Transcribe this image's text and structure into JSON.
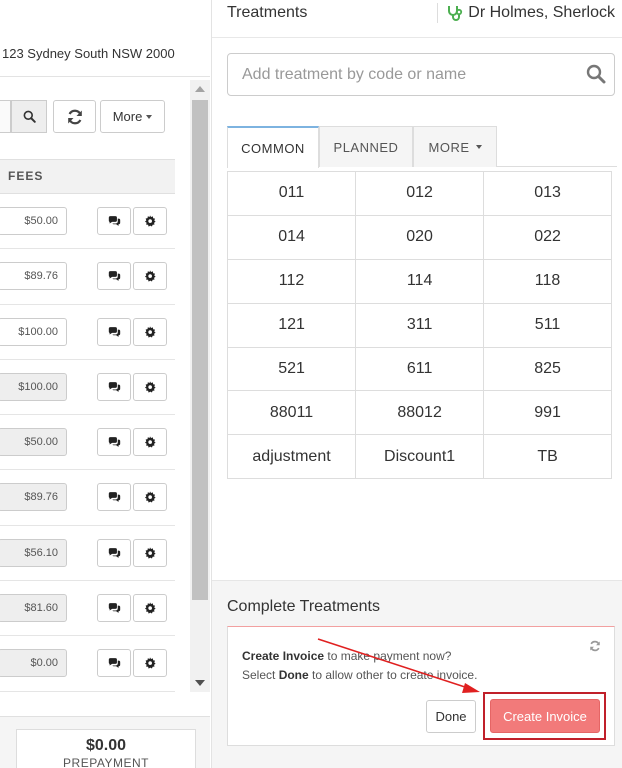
{
  "left": {
    "address": "123 Sydney South NSW 2000",
    "more_label": "More",
    "fees_header": "FEES",
    "fees": [
      {
        "amount": "$50.00",
        "readonly": false
      },
      {
        "amount": "$89.76",
        "readonly": false
      },
      {
        "amount": "$100.00",
        "readonly": false
      },
      {
        "amount": "$100.00",
        "readonly": true
      },
      {
        "amount": "$50.00",
        "readonly": true
      },
      {
        "amount": "$89.76",
        "readonly": true
      },
      {
        "amount": "$56.10",
        "readonly": true
      },
      {
        "amount": "$81.60",
        "readonly": true
      },
      {
        "amount": "$0.00",
        "readonly": true
      }
    ],
    "prepayment": {
      "amount": "$0.00",
      "label": "PREPAYMENT"
    }
  },
  "right": {
    "title": "Treatments",
    "doctor": "Dr Holmes, Sherlock",
    "search_placeholder": "Add treatment by code or name",
    "tabs": [
      {
        "label": "COMMON",
        "active": true
      },
      {
        "label": "PLANNED",
        "active": false
      },
      {
        "label": "MORE",
        "active": false
      }
    ],
    "codes": [
      [
        "011",
        "012",
        "013"
      ],
      [
        "014",
        "020",
        "022"
      ],
      [
        "112",
        "114",
        "118"
      ],
      [
        "121",
        "311",
        "511"
      ],
      [
        "521",
        "611",
        "825"
      ],
      [
        "88011",
        "88012",
        "991"
      ],
      [
        "adjustment",
        "Discount1",
        "TB"
      ]
    ]
  },
  "complete": {
    "title": "Complete Treatments",
    "line1_bold": "Create Invoice",
    "line1_rest": " to make payment now?",
    "line2_pre": "Select ",
    "line2_bold": "Done",
    "line2_rest": " to allow other to create invoice.",
    "done_label": "Done",
    "create_label": "Create Invoice"
  },
  "colors": {
    "accent_tab": "#7db3e0",
    "create_button": "#f27a7a",
    "highlight": "#c0202a",
    "stethoscope": "#4caf50"
  }
}
